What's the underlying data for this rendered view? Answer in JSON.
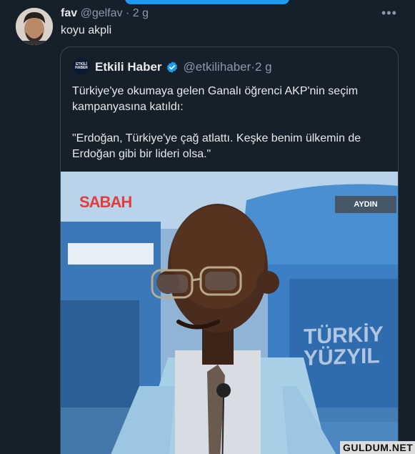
{
  "tweet": {
    "name": "fav",
    "handle": "@gelfav",
    "separator": "·",
    "time": "2 g",
    "text": "koyu akpli",
    "more_icon": "more-horizontal-icon"
  },
  "quote": {
    "name": "Etkili Haber",
    "avatar_text": "ETKİLİ HABER",
    "handle": "@etkilihaber",
    "separator": "·",
    "time": "2 g",
    "text_line1": "Türkiye'ye okumaya gelen Ganalı öğrenci AKP'nin seçim kampanyasına katıldı:",
    "text_line2": "\"Erdoğan, Türkiye'ye çağ atlattı. Keşke benim ülkemin de Erdoğan gibi bir lideri olsa.\""
  },
  "media": {
    "logo": "SABAH",
    "location_badge": "AYDIN",
    "banner_line1": "TÜRKİY",
    "banner_line2": "YÜZYIL"
  },
  "watermark": "GULDUM.NET",
  "colors": {
    "background": "#15202b",
    "text": "#e7e9ea",
    "secondary": "#8b98a5",
    "accent": "#1d9bf0"
  }
}
